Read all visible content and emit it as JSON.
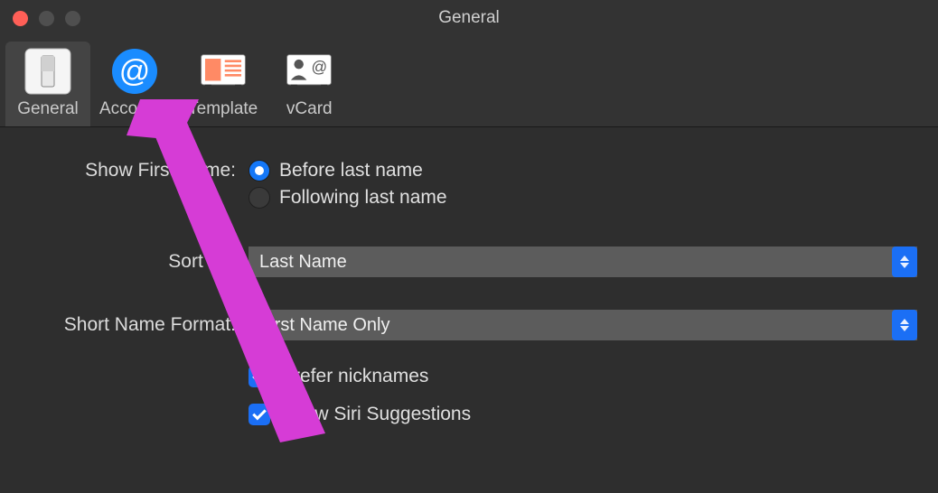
{
  "window": {
    "title": "General"
  },
  "toolbar": {
    "items": [
      {
        "label": "General"
      },
      {
        "label": "Accounts"
      },
      {
        "label": "Template"
      },
      {
        "label": "vCard"
      }
    ]
  },
  "form": {
    "showFirstName": {
      "label": "Show First Name:",
      "options": [
        {
          "label": "Before last name",
          "selected": true
        },
        {
          "label": "Following last name",
          "selected": false
        }
      ]
    },
    "sortBy": {
      "label": "Sort By:",
      "value": "Last Name"
    },
    "shortNameFormat": {
      "label": "Short Name Format:",
      "value": "First Name Only"
    },
    "preferNicknames": {
      "label": "Prefer nicknames",
      "checked": true
    },
    "showSiri": {
      "label": "Show Siri Suggestions",
      "checked": true
    }
  }
}
